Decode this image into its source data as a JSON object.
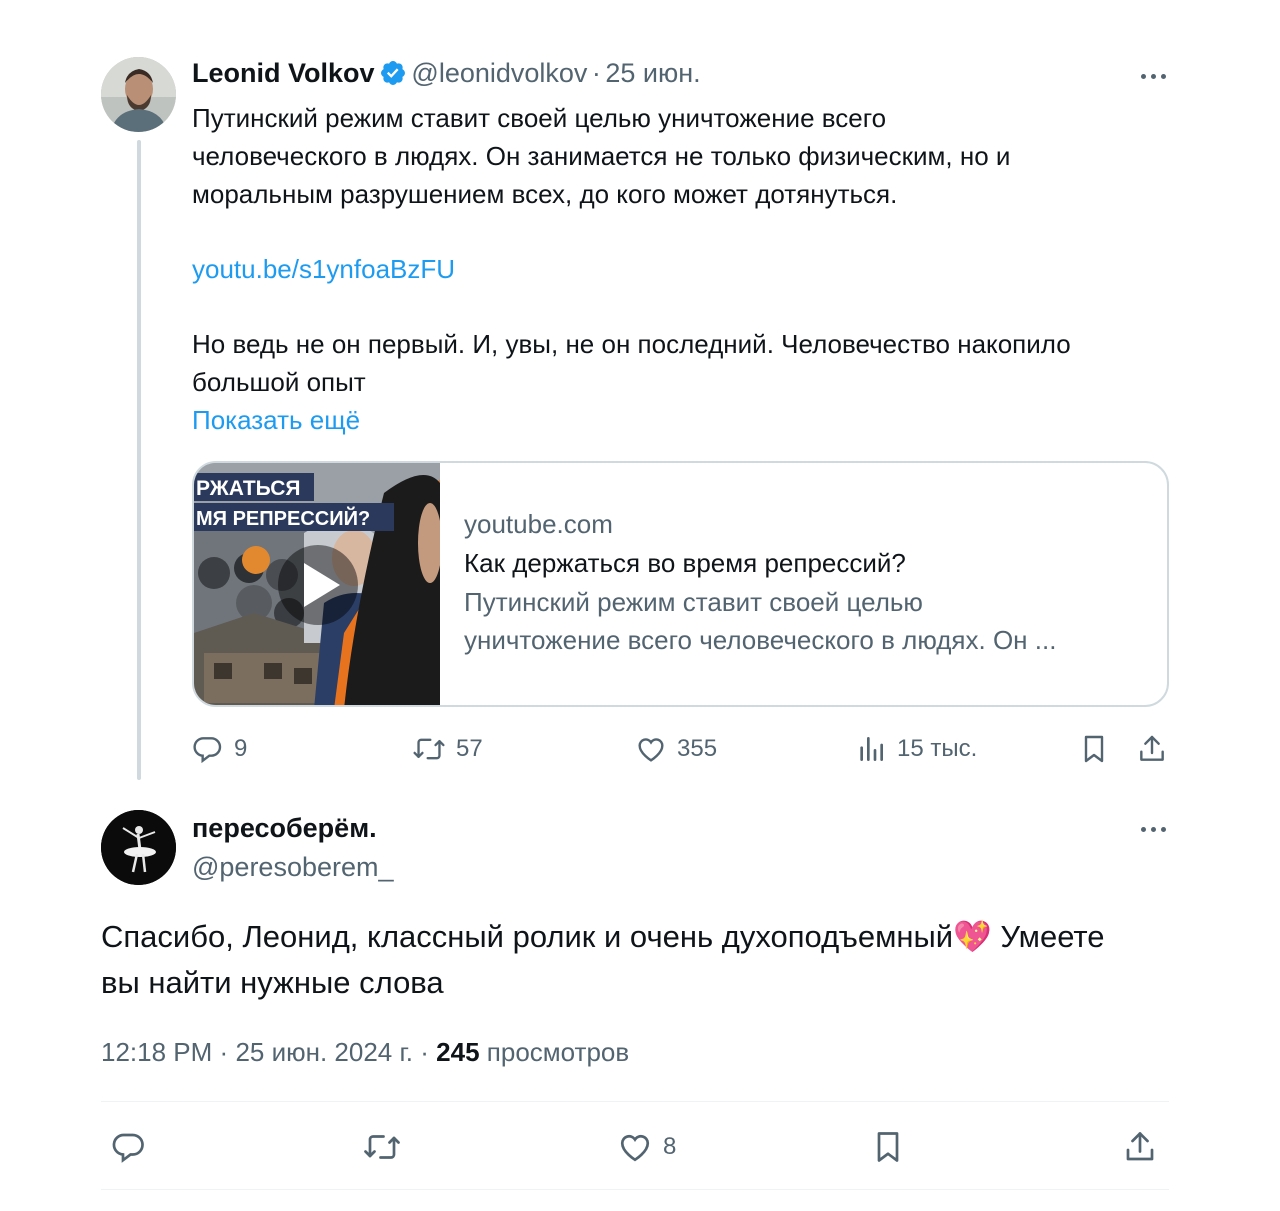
{
  "tweet": {
    "author_name": "Leonid Volkov",
    "handle": "@leonidvolkov",
    "separator": "·",
    "date": "25 июн.",
    "text_lines": [
      "Путинский режим ставит своей целью уничтожение всего",
      "человеческого в людях. Он занимается не только физическим, но и",
      "моральным разрушением всех, до кого может дотянуться."
    ],
    "link": "youtu.be/s1ynfoaBzFU",
    "text2_lines": [
      "Но ведь не он первый. И, увы, не он последний. Человечество накопило",
      "большой опыт"
    ],
    "show_more": "Показать ещё",
    "card": {
      "thumb_text_1": "РЖАТЬСЯ",
      "thumb_text_2": "МЯ РЕПРЕССИЙ?",
      "domain": "youtube.com",
      "title": "Как держаться во время репрессий?",
      "desc_lines": [
        "Путинский режим ставит своей целью",
        "уничтожение всего человеческого в людях. Он ..."
      ]
    },
    "actions": {
      "replies": "9",
      "retweets": "57",
      "likes": "355",
      "views": "15 тыс."
    }
  },
  "reply": {
    "author_name": "пересоберём.",
    "handle": "@peresoberem_",
    "text_part1": "Спасибо, Леонид, классный ролик и очень духоподъемный",
    "emoji": "💖",
    "text_part2": " Умеете",
    "text_line2": "вы найти нужные слова",
    "time": "12:18 PM",
    "separator": "·",
    "date": "25 июн. 2024 г.",
    "separator2": "·",
    "views_count": "245",
    "views_label": "просмотров",
    "actions": {
      "likes": "8"
    }
  },
  "colors": {
    "accent": "#1d9bf0",
    "secondary_text": "#536471",
    "border": "#cfd9de"
  }
}
